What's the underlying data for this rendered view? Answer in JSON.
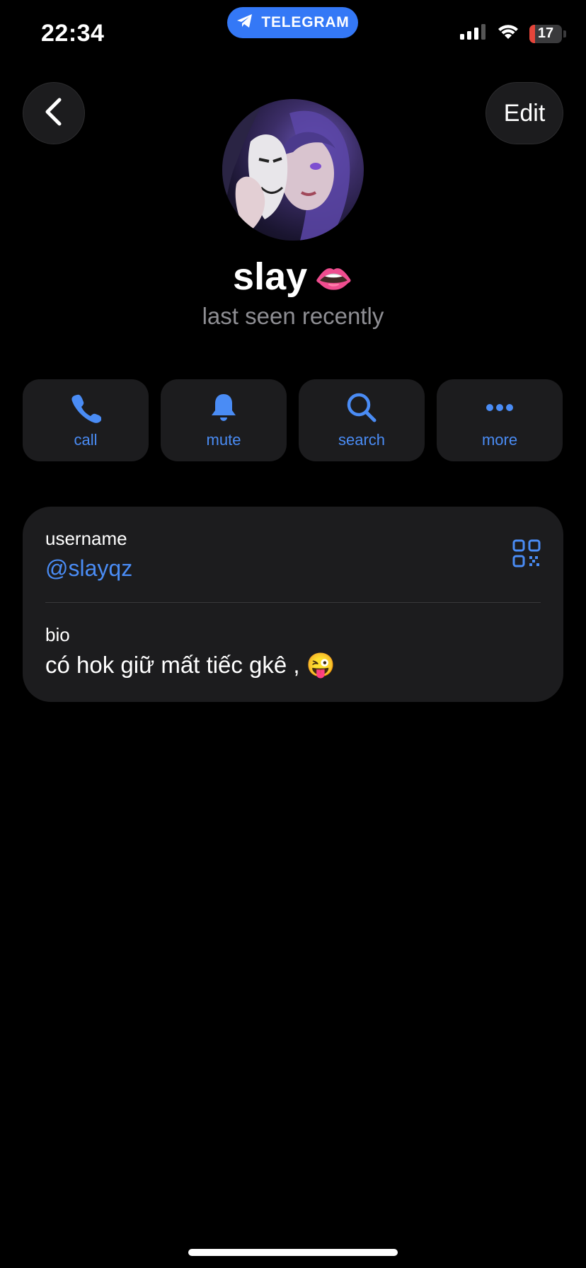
{
  "status_bar": {
    "time": "22:34",
    "app_pill": "TELEGRAM",
    "battery": "17",
    "battery_level": 0.17,
    "icons": [
      "cellular-signal-icon",
      "wifi-icon",
      "battery-icon"
    ]
  },
  "header": {
    "edit_label": "Edit"
  },
  "profile": {
    "name": "slay",
    "name_emoji": "👄",
    "status": "last seen recently"
  },
  "actions": [
    {
      "label": "call",
      "icon": "phone-icon"
    },
    {
      "label": "mute",
      "icon": "bell-icon"
    },
    {
      "label": "search",
      "icon": "search-icon"
    },
    {
      "label": "more",
      "icon": "more-icon"
    }
  ],
  "info": {
    "username_label": "username",
    "username_value": "@slayqz",
    "bio_label": "bio",
    "bio_value": "có hok giữ mất tiếc gkê , 😜"
  },
  "colors": {
    "accent": "#4a8cf5",
    "pill": "#3478f6",
    "card": "#1c1c1e",
    "background": "#000000"
  }
}
